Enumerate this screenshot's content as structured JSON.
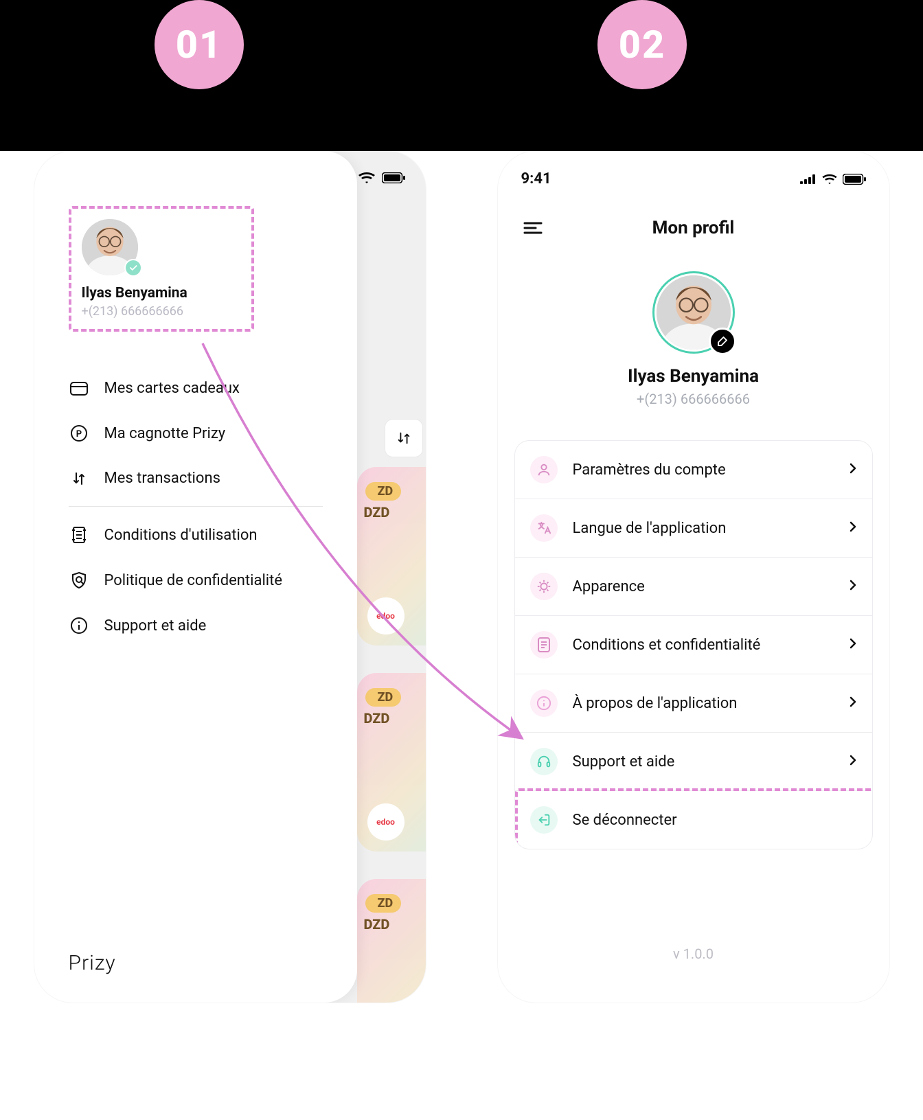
{
  "steps": {
    "first": "01",
    "second": "02"
  },
  "status": {
    "time": "9:41"
  },
  "colors": {
    "accent_pink": "#e08ad4",
    "accent_teal": "#4ad0b0"
  },
  "phone1": {
    "profile": {
      "name": "Ilyas Benyamina",
      "phone": "+(213) 666666666"
    },
    "nav": {
      "cards": "Mes cartes cadeaux",
      "wallet": "Ma cagnotte Prizy",
      "transactions": "Mes transactions",
      "terms": "Conditions d'utilisation",
      "privacy": "Politique de confidentialité",
      "support": "Support et aide"
    },
    "bg_cards": {
      "zd": "ZD",
      "dzd": "DZD",
      "chip": "edoo"
    },
    "brand": "Prizy"
  },
  "phone2": {
    "title": "Mon profil",
    "profile": {
      "name": "Ilyas Benyamina",
      "phone": "+(213) 666666666"
    },
    "settings": {
      "account": "Paramètres du compte",
      "language": "Langue de l'application",
      "appearance": "Apparence",
      "conditions": "Conditions et confidentialité",
      "about": "À propos de l'application",
      "support": "Support et aide",
      "logout": "Se déconnecter"
    },
    "version": "v 1.0.0"
  }
}
